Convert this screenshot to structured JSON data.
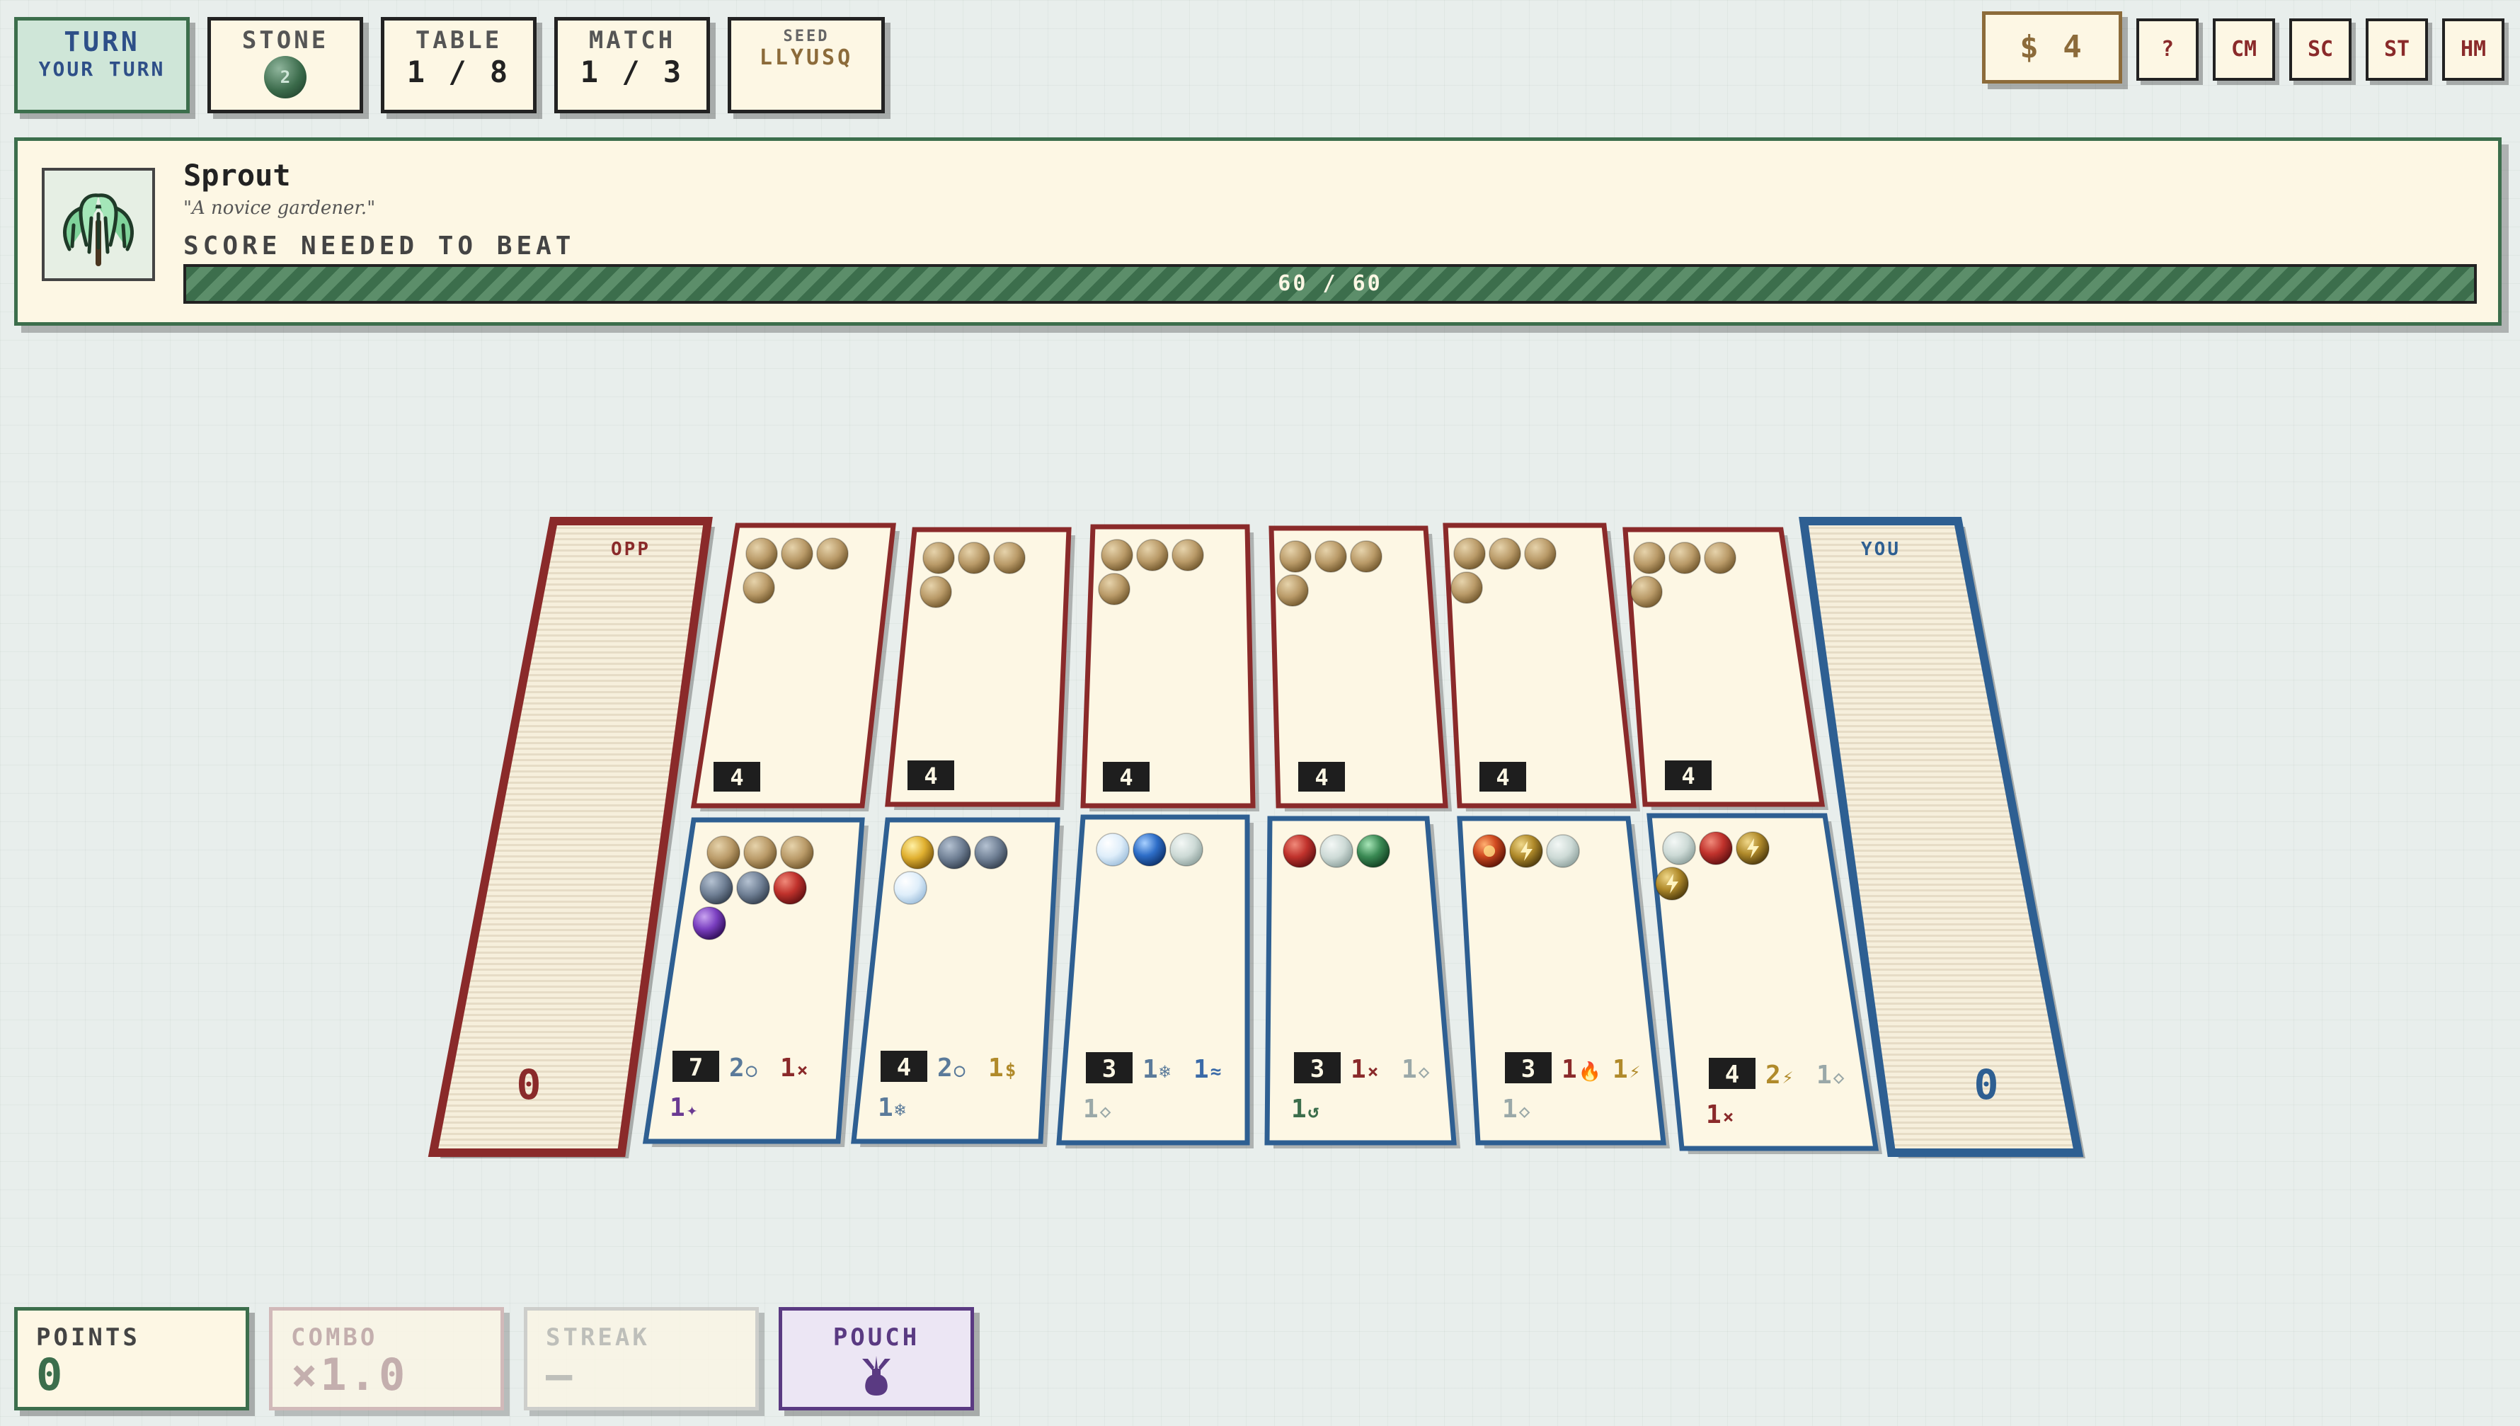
{
  "turn": {
    "label": "TURN",
    "value": "YOUR TURN"
  },
  "stone": {
    "label": "STONE",
    "value": "2"
  },
  "table": {
    "label": "TABLE",
    "value": "1 / 8"
  },
  "match": {
    "label": "MATCH",
    "value": "1 / 3"
  },
  "seed": {
    "label": "SEED",
    "value": "LLYUSQ"
  },
  "money": {
    "value": "$ 4"
  },
  "controls": [
    "?",
    "CM",
    "SC",
    "ST",
    "HM"
  ],
  "opponent": {
    "name": "Sprout",
    "quote": "\"A novice gardener.\"",
    "score_label": "SCORE NEEDED TO BEAT",
    "score_text": "60 / 60",
    "score_progress": 1.0,
    "portrait_icon": "willow-tree-icon"
  },
  "board": {
    "opp_store": {
      "label": "OPP",
      "count": "0"
    },
    "you_store": {
      "label": "YOU",
      "count": "0"
    },
    "opp_pits": [
      {
        "count": "4",
        "stones": [
          "seed",
          "seed",
          "seed",
          "seed"
        ]
      },
      {
        "count": "4",
        "stones": [
          "seed",
          "seed",
          "seed",
          "seed"
        ]
      },
      {
        "count": "4",
        "stones": [
          "seed",
          "seed",
          "seed",
          "seed"
        ]
      },
      {
        "count": "4",
        "stones": [
          "seed",
          "seed",
          "seed",
          "seed"
        ]
      },
      {
        "count": "4",
        "stones": [
          "seed",
          "seed",
          "seed",
          "seed"
        ]
      },
      {
        "count": "4",
        "stones": [
          "seed",
          "seed",
          "seed",
          "seed"
        ]
      }
    ],
    "your_pits": [
      {
        "count": "7",
        "stones": [
          "seed",
          "seed",
          "seed",
          "slate",
          "slate",
          "ruby",
          "amethyst"
        ],
        "effects": [
          {
            "n": "2",
            "sym": "○",
            "color": "#5a7a9a"
          },
          {
            "n": "1",
            "sym": "×",
            "color": "#8a2a2a"
          },
          {
            "n": "1",
            "sym": "✦",
            "color": "#6a3a92"
          }
        ]
      },
      {
        "count": "4",
        "stones": [
          "gold",
          "slate",
          "slate",
          "frost"
        ],
        "effects": [
          {
            "n": "2",
            "sym": "○",
            "color": "#5a7a9a"
          },
          {
            "n": "1",
            "sym": "$",
            "color": "#b08a2a"
          },
          {
            "n": "1",
            "sym": "❄",
            "color": "#5a7a9a"
          }
        ]
      },
      {
        "count": "3",
        "stones": [
          "frost",
          "sapphire",
          "pearl"
        ],
        "effects": [
          {
            "n": "1",
            "sym": "❄",
            "color": "#5a7a9a"
          },
          {
            "n": "1",
            "sym": "≈",
            "color": "#3a6aa8"
          },
          {
            "n": "1",
            "sym": "◇",
            "color": "#9aa8a8"
          }
        ]
      },
      {
        "count": "3",
        "stones": [
          "ruby",
          "pearl",
          "jade"
        ],
        "effects": [
          {
            "n": "1",
            "sym": "×",
            "color": "#8a2a2a"
          },
          {
            "n": "1",
            "sym": "◇",
            "color": "#9aa8a8"
          },
          {
            "n": "1",
            "sym": "↺",
            "color": "#3c6e4c"
          }
        ]
      },
      {
        "count": "3",
        "stones": [
          "ember",
          "bolt",
          "pearl"
        ],
        "effects": [
          {
            "n": "1",
            "sym": "🔥",
            "color": "#8a2a2a"
          },
          {
            "n": "1",
            "sym": "⚡",
            "color": "#b08a2a"
          },
          {
            "n": "1",
            "sym": "◇",
            "color": "#9aa8a8"
          }
        ]
      },
      {
        "count": "4",
        "stones": [
          "pearl",
          "ruby",
          "bolt",
          "bolt"
        ],
        "effects": [
          {
            "n": "2",
            "sym": "⚡",
            "color": "#b08a2a"
          },
          {
            "n": "1",
            "sym": "◇",
            "color": "#9aa8a8"
          },
          {
            "n": "1",
            "sym": "×",
            "color": "#8a2a2a"
          }
        ]
      }
    ]
  },
  "stats": {
    "points": {
      "label": "POINTS",
      "value": "0"
    },
    "combo": {
      "label": "COMBO",
      "value": "×1.0"
    },
    "streak": {
      "label": "STREAK",
      "value": "—"
    },
    "pouch": {
      "label": "POUCH",
      "icon": "pouch-icon"
    }
  },
  "colors": {
    "opp_accent": "#8a2a2a",
    "you_accent": "#2e5f92",
    "banner_accent": "#3c6e4c",
    "pouch_accent": "#5a3a82",
    "money_accent": "#8c6b3a"
  }
}
